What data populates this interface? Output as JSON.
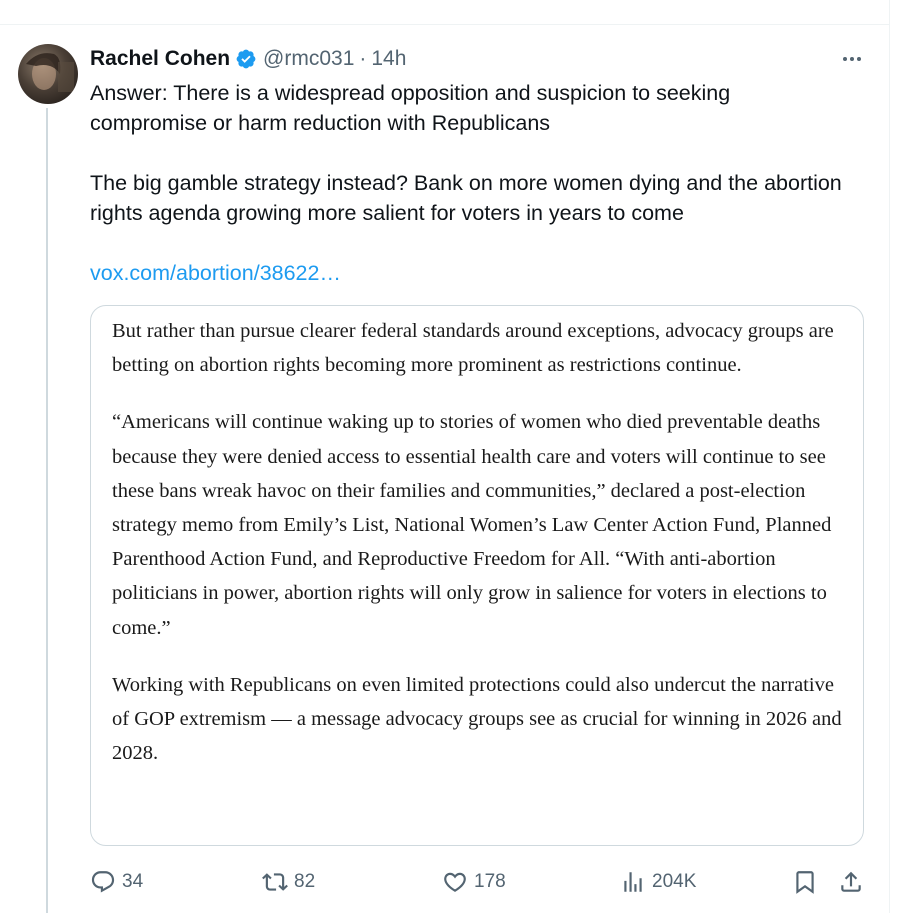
{
  "tweet": {
    "author_name": "Rachel Cohen",
    "handle": "@rmc031",
    "separator": "·",
    "time": "14h",
    "paragraphs": [
      "Answer: There is a widespread opposition and suspicion to seeking compromise or harm reduction with Republicans",
      "The big gamble strategy instead? Bank on more women dying and the abortion rights agenda growing more salient for voters in years to come"
    ],
    "link": "vox.com/abortion/38622…"
  },
  "quote_card": {
    "paragraphs": [
      "But rather than pursue clearer federal standards around exceptions, advocacy groups are betting on abortion rights becoming more prominent as restrictions continue.",
      "“Americans will continue waking up to stories of women who died preventable deaths because they were denied access to essential health care and voters will continue to see these bans wreak havoc on their families and communities,” declared a post-election strategy memo from Emily’s List, National Women’s Law Center Action Fund, Planned Parenthood Action Fund, and Reproductive Freedom for All. “With anti-abortion politicians in power, abortion rights will only grow in salience for voters in elections to come.”",
      "Working with Republicans on even limited protections could also undercut the narrative of GOP extremism — a message advocacy groups see as crucial for winning in 2026 and 2028."
    ]
  },
  "actions": {
    "replies": "34",
    "reposts": "82",
    "likes": "178",
    "views": "204K"
  },
  "icons": {
    "verified": "verified-badge-icon",
    "more": "more-icon",
    "reply": "reply-icon",
    "repost": "repost-icon",
    "like": "like-icon",
    "views": "views-icon",
    "bookmark": "bookmark-icon",
    "share": "share-icon"
  },
  "colors": {
    "text": "#0f1419",
    "secondary": "#536471",
    "link": "#1d9bf0",
    "border": "#cfd9de"
  }
}
